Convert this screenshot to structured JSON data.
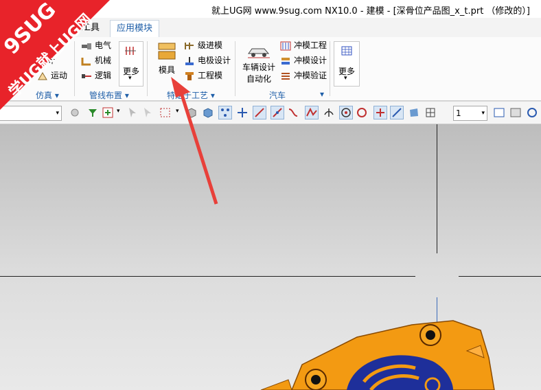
{
  "window": {
    "title": "就上UG网 www.9sug.com NX10.0 - 建模 - [深骨位产品图_x_t.prt （修改的）]"
  },
  "watermark": {
    "line1": "9SUG",
    "line2": "学UG就上UG网",
    "color": "#e8232a"
  },
  "tabs": [
    {
      "label": "工具"
    },
    {
      "label": "应用模块"
    }
  ],
  "ribbon": {
    "sim_group": {
      "items": [
        "设计",
        "运动"
      ],
      "label": "仿真"
    },
    "routing_group": {
      "items": [
        "电气",
        "机械",
        "逻辑"
      ],
      "more": "更多",
      "label": "管线布置"
    },
    "process_group": {
      "big": "模具",
      "items": [
        "级进模",
        "电极设计",
        "工程模"
      ],
      "label": "特定于工艺"
    },
    "auto_group": {
      "big_line1": "车辆设计",
      "big_line2": "自动化",
      "items": [
        "冲模工程",
        "冲模设计",
        "冲模验证"
      ],
      "label": "汽车"
    },
    "more_group": {
      "more": "更多"
    }
  },
  "toolbar": {
    "layer_value": "1"
  },
  "colors": {
    "accent": "#1f5fa8",
    "part_orange": "#f39a12",
    "part_blue": "#1e2f9a",
    "arrow": "#e8403a"
  }
}
